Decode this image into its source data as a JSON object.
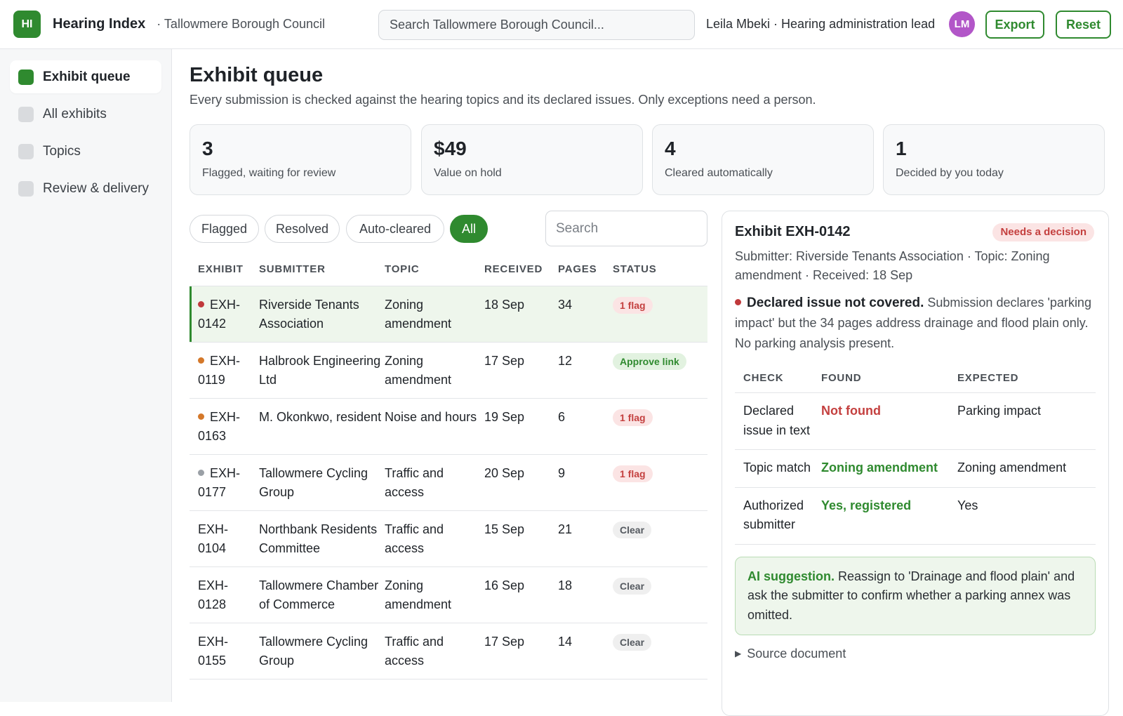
{
  "app": {
    "logo": "HI",
    "title": "Hearing Index",
    "org": "· Tallowmere Borough Council",
    "search_placeholder": "Search Tallowmere Borough Council...",
    "user": "Leila Mbeki · Hearing administration lead",
    "avatar": "LM",
    "export_label": "Export",
    "reset_label": "Reset"
  },
  "sidebar": {
    "items": [
      {
        "label": "Exhibit queue",
        "active": true
      },
      {
        "label": "All exhibits",
        "active": false
      },
      {
        "label": "Topics",
        "active": false
      },
      {
        "label": "Review & delivery",
        "active": false
      }
    ]
  },
  "page": {
    "title": "Exhibit queue",
    "subtitle": "Every submission is checked against the hearing topics and its declared issues. Only exceptions need a person."
  },
  "stats": [
    {
      "value": "3",
      "label": "Flagged, waiting for review"
    },
    {
      "value": "$49",
      "label": "Value on hold"
    },
    {
      "value": "4",
      "label": "Cleared automatically"
    },
    {
      "value": "1",
      "label": "Decided by you today"
    }
  ],
  "filters": {
    "chips": [
      "Flagged",
      "Resolved",
      "Auto-cleared",
      "All"
    ],
    "active": "All",
    "search_placeholder": "Search"
  },
  "table": {
    "headers": [
      "EXHIBIT",
      "SUBMITTER",
      "TOPIC",
      "RECEIVED",
      "PAGES",
      "STATUS"
    ],
    "rows": [
      {
        "id1": "EXH-",
        "id2": "0142",
        "submitter": "Riverside Tenants Association",
        "topic": "Zoning amendment",
        "received": "18 Sep",
        "pages": "34",
        "status": "1 flag",
        "status_kind": "flag",
        "dot": "#c0393b"
      },
      {
        "id1": "EXH-",
        "id2": "0119",
        "submitter": "Halbrook Engineering Ltd",
        "topic": "Zoning amendment",
        "received": "17 Sep",
        "pages": "12",
        "status": "Approve link",
        "status_kind": "approve",
        "dot": "#d4782a"
      },
      {
        "id1": "EXH-",
        "id2": "0163",
        "submitter": "M. Okonkwo, resident",
        "topic": "Noise and hours",
        "received": "19 Sep",
        "pages": "6",
        "status": "1 flag",
        "status_kind": "flag",
        "dot": "#d4782a"
      },
      {
        "id1": "EXH-",
        "id2": "0177",
        "submitter": "Tallowmere Cycling Group",
        "topic": "Traffic and access",
        "received": "20 Sep",
        "pages": "9",
        "status": "1 flag",
        "status_kind": "flag",
        "dot": "#9aa0a6"
      },
      {
        "id1": "EXH-",
        "id2": "0104",
        "submitter": "Northbank Residents Committee",
        "topic": "Traffic and access",
        "received": "15 Sep",
        "pages": "21",
        "status": "Clear",
        "status_kind": "clear",
        "dot": ""
      },
      {
        "id1": "EXH-",
        "id2": "0128",
        "submitter": "Tallowmere Chamber of Commerce",
        "topic": "Zoning amendment",
        "received": "16 Sep",
        "pages": "18",
        "status": "Clear",
        "status_kind": "clear",
        "dot": ""
      },
      {
        "id1": "EXH-",
        "id2": "0155",
        "submitter": "Tallowmere Cycling Group",
        "topic": "Traffic and access",
        "received": "17 Sep",
        "pages": "14",
        "status": "Clear",
        "status_kind": "clear",
        "dot": ""
      }
    ]
  },
  "detail": {
    "title": "Exhibit EXH-0142",
    "badge": "Needs a decision",
    "meta": "Submitter: Riverside Tenants Association · Topic: Zoning amendment · Received: 18 Sep",
    "issue_title": "Declared issue not covered.",
    "issue_text": "Submission declares 'parking impact' but the 34 pages address drainage and flood plain only. No parking analysis present.",
    "check_headers": [
      "CHECK",
      "FOUND",
      "EXPECTED"
    ],
    "checks": [
      {
        "check": "Declared issue in text",
        "found": "Not found",
        "found_kind": "bad",
        "expected": "Parking impact"
      },
      {
        "check": "Topic match",
        "found": "Zoning amendment",
        "found_kind": "good",
        "expected": "Zoning amendment"
      },
      {
        "check": "Authorized submitter",
        "found": "Yes, registered",
        "found_kind": "good",
        "expected": "Yes"
      }
    ],
    "ai_title": "AI suggestion.",
    "ai_text": "Reassign to 'Drainage and flood plain' and ask the submitter to confirm whether a parking annex was omitted.",
    "source_label": "Source document"
  },
  "colors": {
    "accent": "#2f8a2f",
    "danger": "#c4403f",
    "avatar": "#b256c8"
  }
}
